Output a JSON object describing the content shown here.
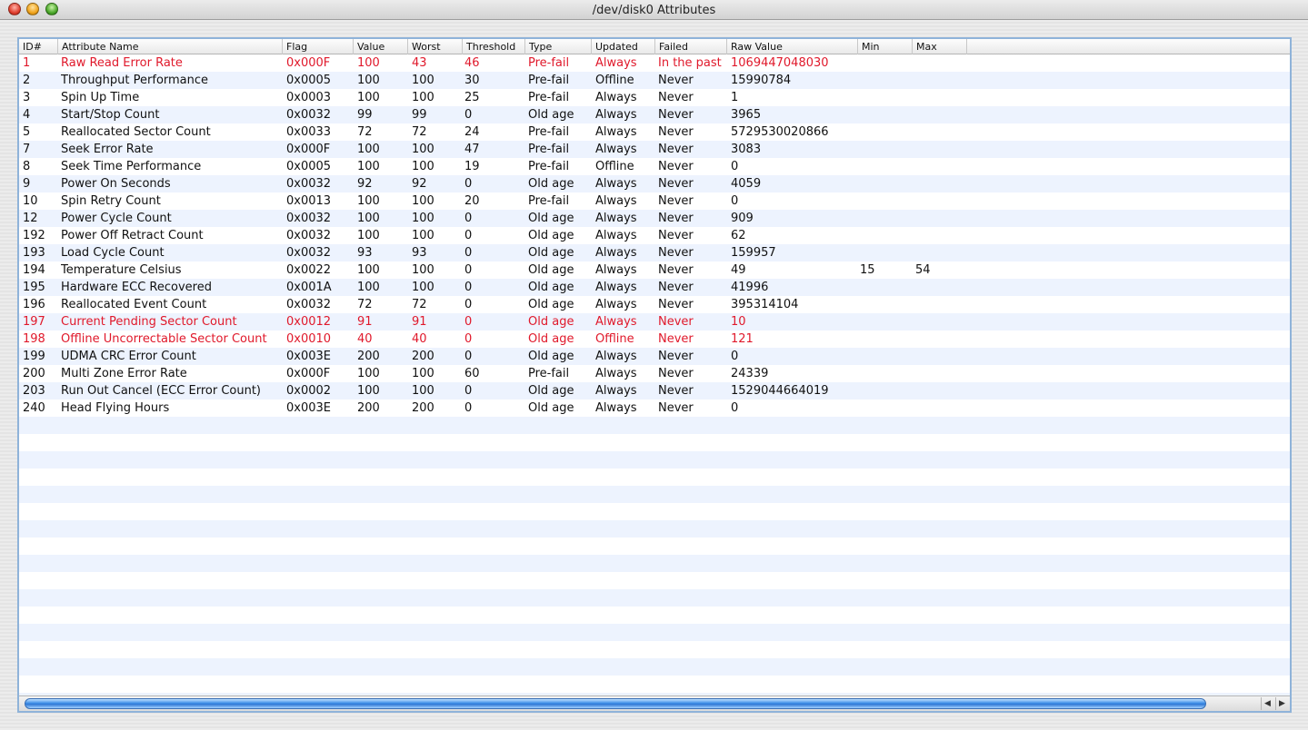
{
  "window": {
    "title": "/dev/disk0 Attributes"
  },
  "colors": {
    "failed_text": "#e0192b",
    "stripe": "#edf3fe",
    "scroll_thumb": "#3d8fe8"
  },
  "table": {
    "columns": [
      "ID#",
      "Attribute Name",
      "Flag",
      "Value",
      "Worst",
      "Threshold",
      "Type",
      "Updated",
      "Failed",
      "Raw Value",
      "Min",
      "Max"
    ],
    "rows": [
      {
        "id": "1",
        "name": "Raw Read Error Rate",
        "flag": "0x000F",
        "value": "100",
        "worst": "43",
        "threshold": "46",
        "type": "Pre-fail",
        "updated": "Always",
        "failed": "In the past",
        "raw": "1069447048030",
        "min": "",
        "max": "",
        "status": "failed"
      },
      {
        "id": "2",
        "name": "Throughput Performance",
        "flag": "0x0005",
        "value": "100",
        "worst": "100",
        "threshold": "30",
        "type": "Pre-fail",
        "updated": "Offline",
        "failed": "Never",
        "raw": "15990784",
        "min": "",
        "max": "",
        "status": "ok"
      },
      {
        "id": "3",
        "name": "Spin Up Time",
        "flag": "0x0003",
        "value": "100",
        "worst": "100",
        "threshold": "25",
        "type": "Pre-fail",
        "updated": "Always",
        "failed": "Never",
        "raw": "1",
        "min": "",
        "max": "",
        "status": "ok"
      },
      {
        "id": "4",
        "name": "Start/Stop Count",
        "flag": "0x0032",
        "value": "99",
        "worst": "99",
        "threshold": "0",
        "type": "Old age",
        "updated": "Always",
        "failed": "Never",
        "raw": "3965",
        "min": "",
        "max": "",
        "status": "ok"
      },
      {
        "id": "5",
        "name": "Reallocated Sector Count",
        "flag": "0x0033",
        "value": "72",
        "worst": "72",
        "threshold": "24",
        "type": "Pre-fail",
        "updated": "Always",
        "failed": "Never",
        "raw": "5729530020866",
        "min": "",
        "max": "",
        "status": "ok"
      },
      {
        "id": "7",
        "name": "Seek Error Rate",
        "flag": "0x000F",
        "value": "100",
        "worst": "100",
        "threshold": "47",
        "type": "Pre-fail",
        "updated": "Always",
        "failed": "Never",
        "raw": "3083",
        "min": "",
        "max": "",
        "status": "ok"
      },
      {
        "id": "8",
        "name": "Seek Time Performance",
        "flag": "0x0005",
        "value": "100",
        "worst": "100",
        "threshold": "19",
        "type": "Pre-fail",
        "updated": "Offline",
        "failed": "Never",
        "raw": "0",
        "min": "",
        "max": "",
        "status": "ok"
      },
      {
        "id": "9",
        "name": "Power On Seconds",
        "flag": "0x0032",
        "value": "92",
        "worst": "92",
        "threshold": "0",
        "type": "Old age",
        "updated": "Always",
        "failed": "Never",
        "raw": "4059",
        "min": "",
        "max": "",
        "status": "ok"
      },
      {
        "id": "10",
        "name": "Spin Retry Count",
        "flag": "0x0013",
        "value": "100",
        "worst": "100",
        "threshold": "20",
        "type": "Pre-fail",
        "updated": "Always",
        "failed": "Never",
        "raw": "0",
        "min": "",
        "max": "",
        "status": "ok"
      },
      {
        "id": "12",
        "name": "Power Cycle Count",
        "flag": "0x0032",
        "value": "100",
        "worst": "100",
        "threshold": "0",
        "type": "Old age",
        "updated": "Always",
        "failed": "Never",
        "raw": "909",
        "min": "",
        "max": "",
        "status": "ok"
      },
      {
        "id": "192",
        "name": "Power Off Retract Count",
        "flag": "0x0032",
        "value": "100",
        "worst": "100",
        "threshold": "0",
        "type": "Old age",
        "updated": "Always",
        "failed": "Never",
        "raw": "62",
        "min": "",
        "max": "",
        "status": "ok"
      },
      {
        "id": "193",
        "name": "Load Cycle Count",
        "flag": "0x0032",
        "value": "93",
        "worst": "93",
        "threshold": "0",
        "type": "Old age",
        "updated": "Always",
        "failed": "Never",
        "raw": "159957",
        "min": "",
        "max": "",
        "status": "ok"
      },
      {
        "id": "194",
        "name": "Temperature Celsius",
        "flag": "0x0022",
        "value": "100",
        "worst": "100",
        "threshold": "0",
        "type": "Old age",
        "updated": "Always",
        "failed": "Never",
        "raw": "49",
        "min": "15",
        "max": "54",
        "status": "ok"
      },
      {
        "id": "195",
        "name": "Hardware ECC Recovered",
        "flag": "0x001A",
        "value": "100",
        "worst": "100",
        "threshold": "0",
        "type": "Old age",
        "updated": "Always",
        "failed": "Never",
        "raw": "41996",
        "min": "",
        "max": "",
        "status": "ok"
      },
      {
        "id": "196",
        "name": "Reallocated Event Count",
        "flag": "0x0032",
        "value": "72",
        "worst": "72",
        "threshold": "0",
        "type": "Old age",
        "updated": "Always",
        "failed": "Never",
        "raw": "395314104",
        "min": "",
        "max": "",
        "status": "ok"
      },
      {
        "id": "197",
        "name": "Current Pending Sector Count",
        "flag": "0x0012",
        "value": "91",
        "worst": "91",
        "threshold": "0",
        "type": "Old age",
        "updated": "Always",
        "failed": "Never",
        "raw": "10",
        "min": "",
        "max": "",
        "status": "failed"
      },
      {
        "id": "198",
        "name": "Offline Uncorrectable Sector Count",
        "flag": "0x0010",
        "value": "40",
        "worst": "40",
        "threshold": "0",
        "type": "Old age",
        "updated": "Offline",
        "failed": "Never",
        "raw": "121",
        "min": "",
        "max": "",
        "status": "failed"
      },
      {
        "id": "199",
        "name": "UDMA CRC Error Count",
        "flag": "0x003E",
        "value": "200",
        "worst": "200",
        "threshold": "0",
        "type": "Old age",
        "updated": "Always",
        "failed": "Never",
        "raw": "0",
        "min": "",
        "max": "",
        "status": "ok"
      },
      {
        "id": "200",
        "name": "Multi Zone Error Rate",
        "flag": "0x000F",
        "value": "100",
        "worst": "100",
        "threshold": "60",
        "type": "Pre-fail",
        "updated": "Always",
        "failed": "Never",
        "raw": "24339",
        "min": "",
        "max": "",
        "status": "ok"
      },
      {
        "id": "203",
        "name": "Run Out Cancel (ECC Error Count)",
        "flag": "0x0002",
        "value": "100",
        "worst": "100",
        "threshold": "0",
        "type": "Old age",
        "updated": "Always",
        "failed": "Never",
        "raw": "1529044664019",
        "min": "",
        "max": "",
        "status": "ok"
      },
      {
        "id": "240",
        "name": "Head Flying Hours",
        "flag": "0x003E",
        "value": "200",
        "worst": "200",
        "threshold": "0",
        "type": "Old age",
        "updated": "Always",
        "failed": "Never",
        "raw": "0",
        "min": "",
        "max": "",
        "status": "ok"
      }
    ]
  },
  "scrollbar": {
    "left_arrow": "◀",
    "right_arrow": "▶"
  }
}
